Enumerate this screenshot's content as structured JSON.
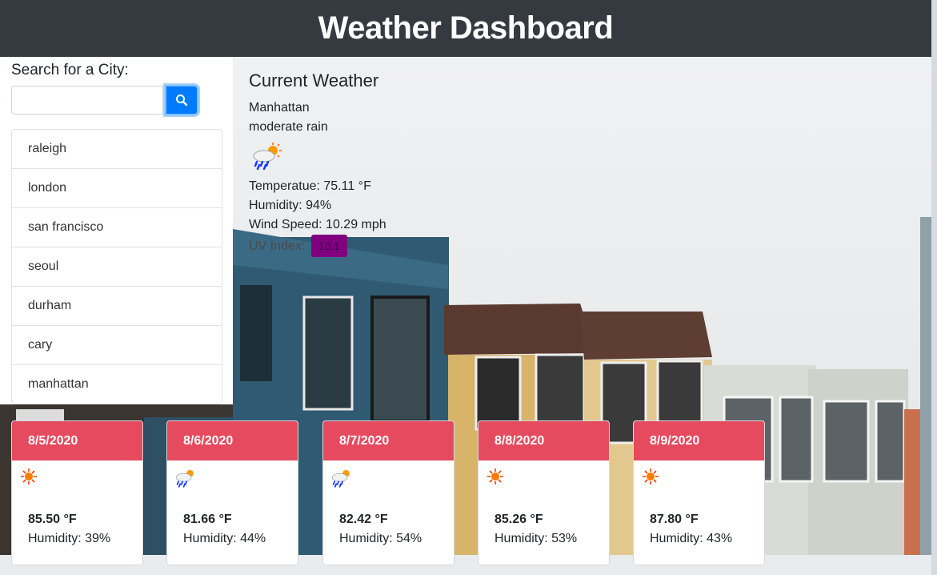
{
  "header": {
    "title": "Weather Dashboard"
  },
  "search": {
    "label": "Search for a City:",
    "placeholder": "",
    "value": ""
  },
  "cities": [
    "raleigh",
    "london",
    "san francisco",
    "seoul",
    "durham",
    "cary",
    "manhattan"
  ],
  "current": {
    "heading": "Current Weather",
    "city": "Manhattan",
    "description": "moderate rain",
    "icon": "rain-sun-icon",
    "temperature": "Temperatue: 75.11 °F",
    "humidity": "Humidity: 94%",
    "wind": "Wind Speed: 10.29 mph",
    "uv_label": "UV Index:",
    "uv_value": "10.1",
    "uv_color": "#800080"
  },
  "forecast": [
    {
      "date": "8/5/2020",
      "icon": "sun-icon",
      "temp": "85.50 °F",
      "humidity": "Humidity: 39%"
    },
    {
      "date": "8/6/2020",
      "icon": "rain-sun-icon",
      "temp": "81.66 °F",
      "humidity": "Humidity: 44%"
    },
    {
      "date": "8/7/2020",
      "icon": "rain-sun-icon",
      "temp": "82.42 °F",
      "humidity": "Humidity: 54%"
    },
    {
      "date": "8/8/2020",
      "icon": "sun-icon",
      "temp": "85.26 °F",
      "humidity": "Humidity: 53%"
    },
    {
      "date": "8/9/2020",
      "icon": "sun-icon",
      "temp": "87.80 °F",
      "humidity": "Humidity: 43%"
    }
  ],
  "colors": {
    "header_bg": "#343a40",
    "accent": "#007bff",
    "card_header": "#e64a5f"
  }
}
